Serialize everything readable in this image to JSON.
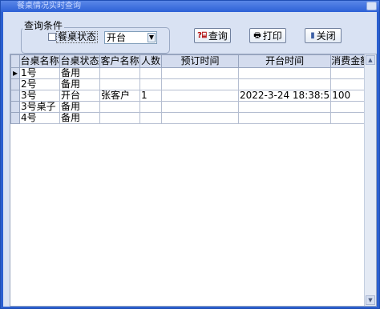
{
  "window": {
    "title": "餐桌情况实时查询"
  },
  "query": {
    "group_label": "查询条件",
    "status_checkbox_label": "餐桌状态",
    "status_value": "开台"
  },
  "buttons": {
    "query_label": "查询",
    "print_label": "打印",
    "close_label": "关闭"
  },
  "table": {
    "columns": [
      "台桌名称",
      "台桌状态",
      "客户名称",
      "人数",
      "预订时间",
      "开台时间",
      "消费金额"
    ],
    "rows": [
      [
        "1号",
        "备用",
        "",
        "",
        "",
        "",
        ""
      ],
      [
        "2号",
        "备用",
        "",
        "",
        "",
        "",
        ""
      ],
      [
        "3号",
        "开台",
        "张客户",
        "1",
        "",
        "2022-3-24 18:38:5",
        "100"
      ],
      [
        "3号桌子",
        "备用",
        "",
        "",
        "",
        "",
        ""
      ],
      [
        "4号",
        "备用",
        "",
        "",
        "",
        "",
        ""
      ]
    ]
  }
}
